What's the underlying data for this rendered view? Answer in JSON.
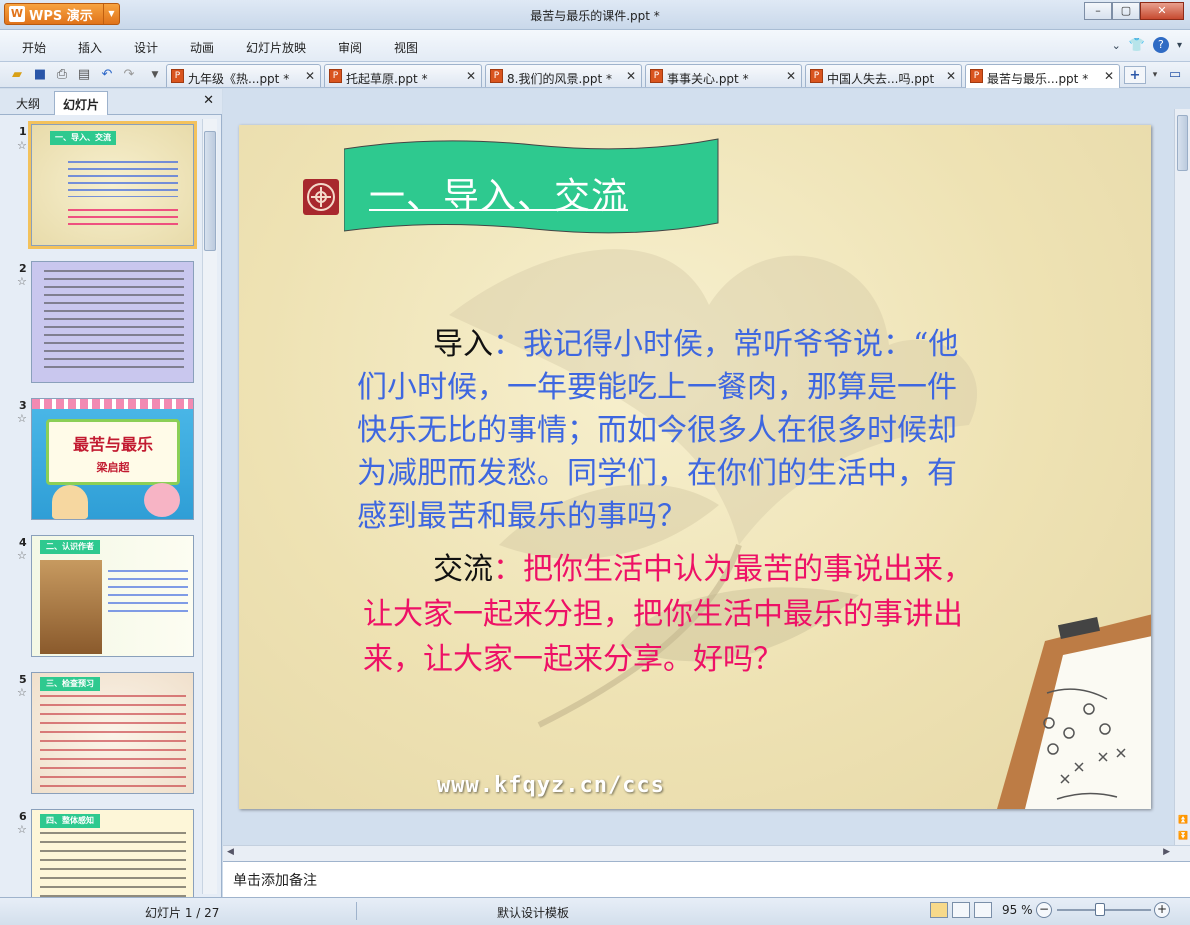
{
  "window": {
    "app_name": "WPS 演示",
    "doc_title": "最苦与最乐的课件.ppt *"
  },
  "menu": [
    "开始",
    "插入",
    "设计",
    "动画",
    "幻灯片放映",
    "审阅",
    "视图"
  ],
  "doc_tabs": [
    {
      "label": "九年级《热...ppt *"
    },
    {
      "label": "托起草原.ppt *"
    },
    {
      "label": "8.我们的风景.ppt *"
    },
    {
      "label": "事事关心.ppt *"
    },
    {
      "label": "中国人失去...吗.ppt"
    },
    {
      "label": "最苦与最乐...ppt *"
    }
  ],
  "panel": {
    "tab_outline": "大纲",
    "tab_slides": "幻灯片"
  },
  "thumbnails": [
    {
      "num": "1",
      "heading": "一、导入、交流"
    },
    {
      "num": "2"
    },
    {
      "num": "3",
      "title": "最苦与最乐",
      "author": "梁启超"
    },
    {
      "num": "4",
      "heading": "二、认识作者"
    },
    {
      "num": "5",
      "heading": "三、检查预习"
    },
    {
      "num": "6",
      "heading": "四、整体感知"
    }
  ],
  "slide": {
    "title": "一、导入、交流",
    "p1_label": "导入",
    "p1_colon": "：",
    "p1_line1": "我记得小时侯，常听爷爷说：“他",
    "p1_line2": "们小时候，一年要能吃上一餐肉，那算是一件",
    "p1_line3": "快乐无比的事情；而如今很多人在很多时候却",
    "p1_line4": "为减肥而发愁。同学们，在你们的生活中，有",
    "p1_line5": "感到最苦和最乐的事吗？",
    "p2_label": "交流",
    "p2_line1": "：把你生活中认为最苦的事说出来，",
    "p2_line2": "让大家一起来分担，把你生活中最乐的事讲出",
    "p2_line3": "来，让大家一起来分享。好吗？",
    "watermark": "www.kfqyz.cn/ccs"
  },
  "notes_placeholder": "单击添加备注",
  "status": {
    "slide_counter": "幻灯片 1 / 27",
    "template": "默认设计模板",
    "zoom": "95 %"
  },
  "colors": {
    "title_bg": "#2ec98f",
    "p1_text": "#3e67e0",
    "p2_text": "#ee1166"
  }
}
